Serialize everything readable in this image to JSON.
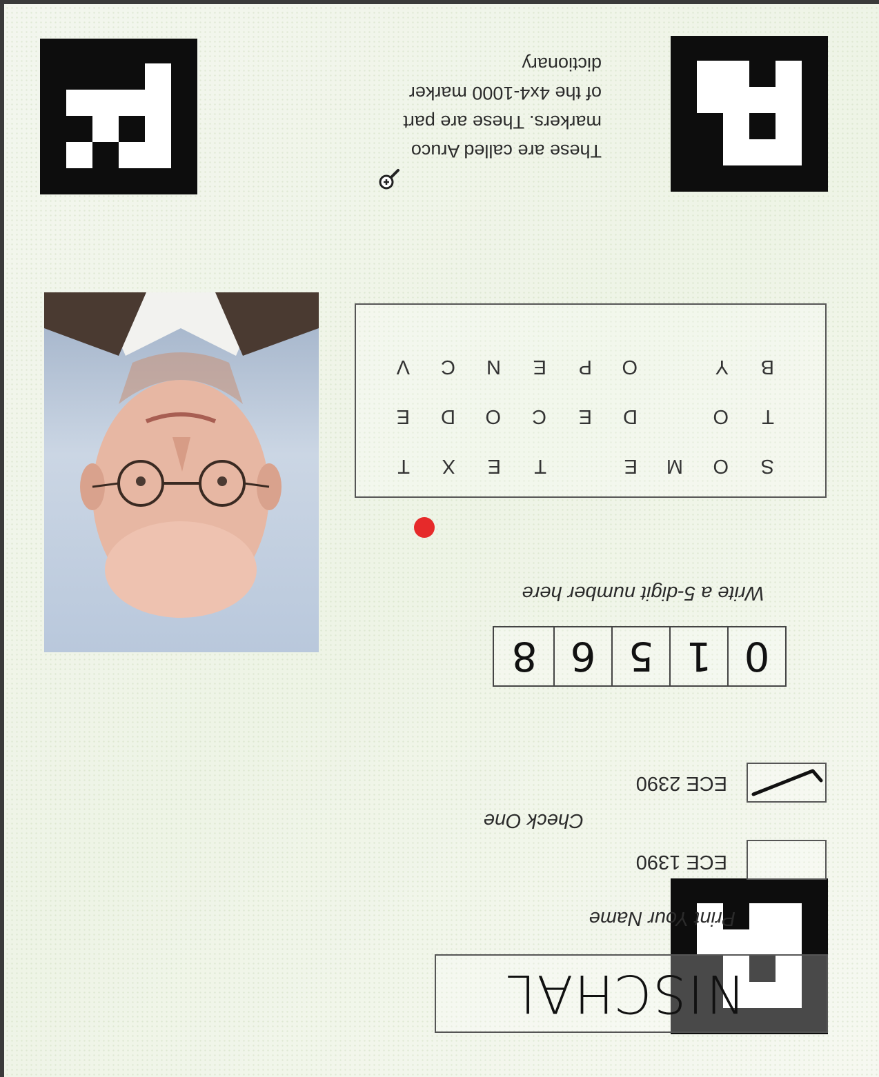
{
  "form": {
    "name_label": "Print Your Name",
    "name_value": "NISCHAL",
    "check_label": "Check One",
    "options": [
      {
        "label": "ECE 2390",
        "checked": true
      },
      {
        "label": "ECE 1390",
        "checked": false
      }
    ],
    "number_label": "Write a 5-digit number here",
    "digits": [
      "0",
      "1",
      "5",
      "6",
      "8"
    ],
    "marker_note_lines": [
      "These are called Aruco",
      "markers. These are part",
      "of the 4x4-1000 marker",
      "dictionary"
    ],
    "letter_grid": [
      [
        "S",
        "O",
        "M",
        "E",
        "",
        "T",
        "E",
        "X",
        "T"
      ],
      [
        "T",
        "O",
        "",
        "D",
        "E",
        "C",
        "O",
        "D",
        "E"
      ],
      [
        "B",
        "Y",
        "",
        "O",
        "P",
        "E",
        "N",
        "C",
        "V"
      ]
    ]
  },
  "colors": {
    "dot": "#e62a2a",
    "marker": "#0d0d0d",
    "paper": "#f3f6ee"
  },
  "icons": {
    "magnifier": "zoom-in-icon",
    "checkmark": "checkmark-icon"
  }
}
